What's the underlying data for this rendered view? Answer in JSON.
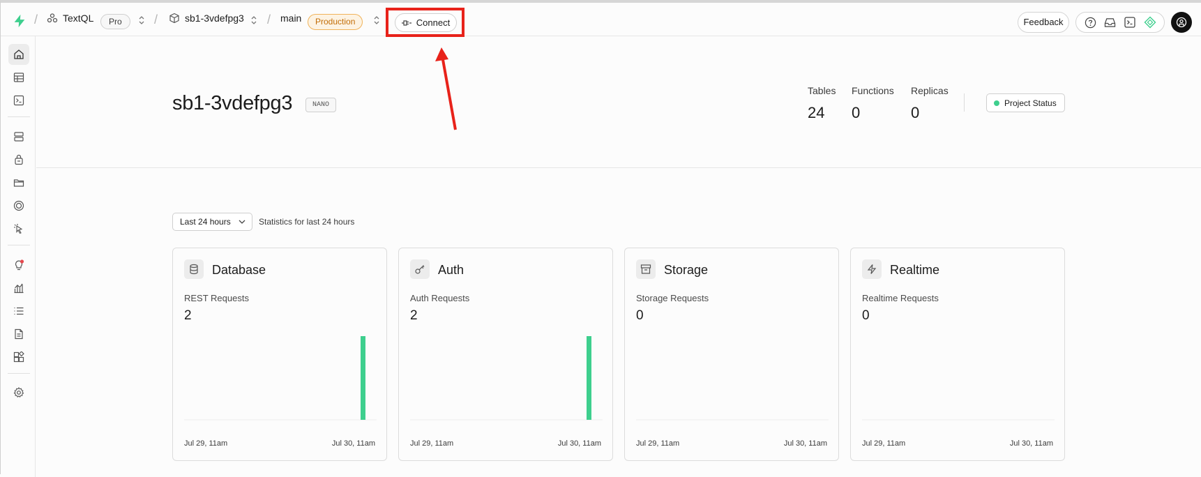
{
  "topbar": {
    "org_name": "TextQL",
    "plan_badge": "Pro",
    "project_ref": "sb1-3vdefpg3",
    "branch": "main",
    "env_badge": "Production",
    "connect_label": "Connect",
    "feedback_label": "Feedback"
  },
  "project": {
    "title": "sb1-3vdefpg3",
    "compute_badge": "NANO",
    "stats": [
      {
        "label": "Tables",
        "value": "24"
      },
      {
        "label": "Functions",
        "value": "0"
      },
      {
        "label": "Replicas",
        "value": "0"
      }
    ],
    "status_label": "Project Status",
    "status_color": "#3ecf8e"
  },
  "filter": {
    "range_label": "Last 24 hours",
    "range_note": "Statistics for last 24 hours"
  },
  "cards": [
    {
      "title": "Database",
      "icon": "database-icon",
      "metric_label": "REST Requests",
      "metric_value": "2",
      "x_start": "Jul 29, 11am",
      "x_end": "Jul 30, 11am",
      "series_value_latest": 2
    },
    {
      "title": "Auth",
      "icon": "key-icon",
      "metric_label": "Auth Requests",
      "metric_value": "2",
      "x_start": "Jul 29, 11am",
      "x_end": "Jul 30, 11am",
      "series_value_latest": 2
    },
    {
      "title": "Storage",
      "icon": "archive-icon",
      "metric_label": "Storage Requests",
      "metric_value": "0",
      "x_start": "Jul 29, 11am",
      "x_end": "Jul 30, 11am",
      "series_value_latest": 0
    },
    {
      "title": "Realtime",
      "icon": "zap-icon",
      "metric_label": "Realtime Requests",
      "metric_value": "0",
      "x_start": "Jul 29, 11am",
      "x_end": "Jul 30, 11am",
      "series_value_latest": 0
    }
  ],
  "colors": {
    "brand": "#3ecf8e",
    "annotation": "#e8221a",
    "production": "#c26d07"
  },
  "sidebar_icons": [
    "home-icon",
    "table-editor-icon",
    "sql-editor-icon",
    "database-icon",
    "auth-icon",
    "storage-icon",
    "edge-functions-icon",
    "realtime-icon",
    "advisors-icon",
    "reports-icon",
    "logs-icon",
    "api-docs-icon",
    "integrations-icon",
    "settings-icon"
  ]
}
